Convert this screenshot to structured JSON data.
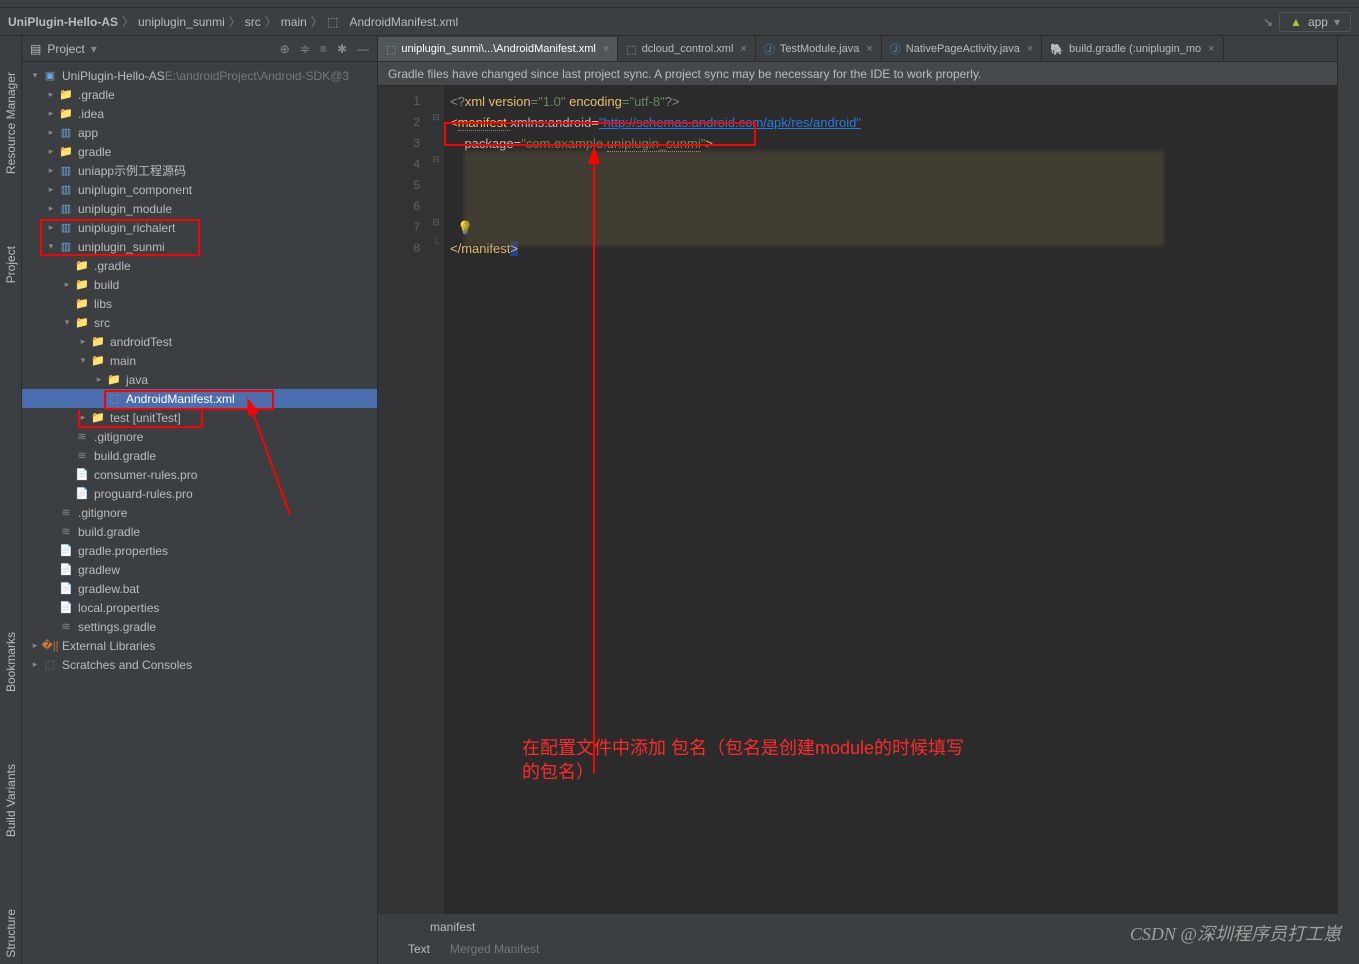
{
  "breadcrumb": {
    "root": "UniPlugin-Hello-AS",
    "path1": "uniplugin_sunmi",
    "path2": "src",
    "path3": "main",
    "file": "AndroidManifest.xml",
    "run_config": "app"
  },
  "panel": {
    "title": "Project",
    "project_name": "UniPlugin-Hello-AS",
    "project_path": "E:\\androidProject\\Android-SDK@3"
  },
  "tree": [
    {
      "d": 0,
      "arrow": "v",
      "icon": "proj",
      "label": "UniPlugin-Hello-AS",
      "tail": "  E:\\androidProject\\Android-SDK@3",
      "dim": true
    },
    {
      "d": 1,
      "arrow": ">",
      "icon": "folder-o",
      "label": ".gradle"
    },
    {
      "d": 1,
      "arrow": ">",
      "icon": "folder-o",
      "label": ".idea"
    },
    {
      "d": 1,
      "arrow": ">",
      "icon": "module",
      "label": "app"
    },
    {
      "d": 1,
      "arrow": ">",
      "icon": "folder-o",
      "label": "gradle"
    },
    {
      "d": 1,
      "arrow": ">",
      "icon": "module",
      "label": "uniapp示例工程源码"
    },
    {
      "d": 1,
      "arrow": ">",
      "icon": "module",
      "label": "uniplugin_component"
    },
    {
      "d": 1,
      "arrow": ">",
      "icon": "module",
      "label": "uniplugin_module"
    },
    {
      "d": 1,
      "arrow": ">",
      "icon": "module",
      "label": "uniplugin_richalert",
      "box": "richalert"
    },
    {
      "d": 1,
      "arrow": "v",
      "icon": "module",
      "label": "uniplugin_sunmi",
      "box": "sunmi"
    },
    {
      "d": 2,
      "arrow": "",
      "icon": "folder-o",
      "label": ".gradle"
    },
    {
      "d": 2,
      "arrow": ">",
      "icon": "folder-o",
      "label": "build"
    },
    {
      "d": 2,
      "arrow": "",
      "icon": "folder-b",
      "label": "libs"
    },
    {
      "d": 2,
      "arrow": "v",
      "icon": "folder-b",
      "label": "src"
    },
    {
      "d": 3,
      "arrow": ">",
      "icon": "folder-g",
      "label": "androidTest"
    },
    {
      "d": 3,
      "arrow": "v",
      "icon": "folder-b",
      "label": "main"
    },
    {
      "d": 4,
      "arrow": ">",
      "icon": "folder-b",
      "label": "java"
    },
    {
      "d": 4,
      "arrow": "",
      "icon": "xml",
      "label": "AndroidManifest.xml",
      "selected": true,
      "box": "manifest"
    },
    {
      "d": 3,
      "arrow": ">",
      "icon": "folder-g",
      "label": "test [unitTest]",
      "box": "test"
    },
    {
      "d": 2,
      "arrow": "",
      "icon": "file",
      "label": ".gitignore"
    },
    {
      "d": 2,
      "arrow": "",
      "icon": "file",
      "label": "build.gradle"
    },
    {
      "d": 2,
      "arrow": "",
      "icon": "file-p",
      "label": "consumer-rules.pro"
    },
    {
      "d": 2,
      "arrow": "",
      "icon": "file-p",
      "label": "proguard-rules.pro"
    },
    {
      "d": 1,
      "arrow": "",
      "icon": "file",
      "label": ".gitignore"
    },
    {
      "d": 1,
      "arrow": "",
      "icon": "file",
      "label": "build.gradle"
    },
    {
      "d": 1,
      "arrow": "",
      "icon": "file-c",
      "label": "gradle.properties"
    },
    {
      "d": 1,
      "arrow": "",
      "icon": "file-p",
      "label": "gradlew"
    },
    {
      "d": 1,
      "arrow": "",
      "icon": "file-p",
      "label": "gradlew.bat"
    },
    {
      "d": 1,
      "arrow": "",
      "icon": "file-c",
      "label": "local.properties"
    },
    {
      "d": 1,
      "arrow": "",
      "icon": "file",
      "label": "settings.gradle"
    },
    {
      "d": 0,
      "arrow": ">",
      "icon": "lib",
      "label": "External Libraries"
    },
    {
      "d": 0,
      "arrow": ">",
      "icon": "scratch",
      "label": "Scratches and Consoles"
    }
  ],
  "tabs": [
    {
      "icon": "xml",
      "label": "uniplugin_sunmi\\...\\AndroidManifest.xml",
      "active": true
    },
    {
      "icon": "xml",
      "label": "dcloud_control.xml"
    },
    {
      "icon": "java",
      "label": "TestModule.java"
    },
    {
      "icon": "java",
      "label": "NativePageActivity.java"
    },
    {
      "icon": "gradle",
      "label": "build.gradle (:uniplugin_mo"
    }
  ],
  "banner": "Gradle files have changed since last project sync. A project sync may be necessary for the IDE to work properly.",
  "code": {
    "l1a": "<?",
    "l1b": "xml version",
    "l1c": "=\"1.0\"",
    "l1d": " encoding",
    "l1e": "=\"utf-8\"",
    "l1f": "?>",
    "l2a": "<",
    "l2b": "manifest ",
    "l2c": "xmlns:",
    "l2d": "android",
    "l2e": "=",
    "l2f": "\"http://schemas.android.com/apk/res/android\"",
    "l3a": "    ",
    "l3b": "package",
    "l3c": "=",
    "l3d": "\"com.example.",
    "l3e": "uniplugin_sunmi",
    "l3f": "\"",
    "l3g": ">",
    "l8a": "</",
    "l8b": "manifest",
    "l8c": ">"
  },
  "left_tabs": {
    "rm": "Resource Manager",
    "proj": "Project",
    "bm": "Bookmarks",
    "bv": "Build Variants",
    "struct": "Structure"
  },
  "status": {
    "manifest": "manifest",
    "text": "Text",
    "merged": "Merged Manifest"
  },
  "annotation": {
    "line1": "在配置文件中添加 包名（包名是创建module的时候填写",
    "line2": "的包名）"
  },
  "watermark": "CSDN @深圳程序员打工崽"
}
